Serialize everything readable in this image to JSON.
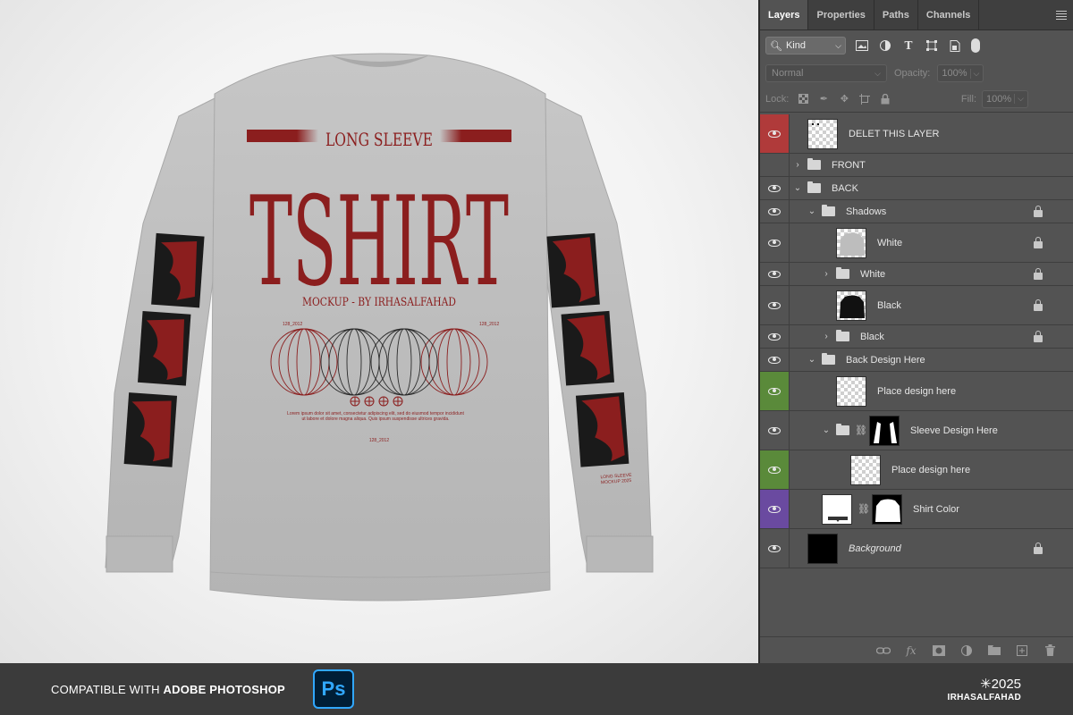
{
  "colors": {
    "accent_red": "#8b1e1e",
    "shirt_gray": "#bdbdbd",
    "layer_red": "#b03a3a",
    "layer_green": "#5a8a3a",
    "layer_purple": "#6a4aa0"
  },
  "mockup": {
    "title_top": "LONG SLEEVE",
    "title_main": "TSHIRT",
    "subtitle": "MOCKUP - BY IRHASALFAHAD",
    "small_left": "128_2012",
    "small_right": "128_2012",
    "lorem": "Lorem ipsum dolor sit amet, consectetur adipiscing elit, sed do eiusmod tempor incididunt ut labore et dolore magna aliqua. Quis ipsum suspendisse ultrices gravida.",
    "small_bottom": "128_2012",
    "sleeve_text": "LONG SLEEVE MOCKUP 2025"
  },
  "panel": {
    "tabs": [
      "Layers",
      "Properties",
      "Paths",
      "Channels"
    ],
    "active_tab": "Layers",
    "filter_kind": "Kind",
    "blend_mode": "Normal",
    "opacity_label": "Opacity:",
    "opacity_value": "100%",
    "lock_label": "Lock:",
    "fill_label": "Fill:",
    "fill_value": "100%",
    "layers": [
      {
        "name": "DELET THIS LAYER",
        "visible": true,
        "color": "red",
        "indent": 0,
        "type": "layer",
        "thumb": "checker-dark",
        "locked": false
      },
      {
        "name": "FRONT",
        "visible": false,
        "color": "",
        "indent": 0,
        "type": "group-closed",
        "locked": false
      },
      {
        "name": "BACK",
        "visible": true,
        "color": "",
        "indent": 0,
        "type": "group-open",
        "locked": false
      },
      {
        "name": "Shadows",
        "visible": true,
        "color": "",
        "indent": 1,
        "type": "group-open",
        "locked": true
      },
      {
        "name": "White",
        "visible": true,
        "color": "",
        "indent": 2,
        "type": "layer",
        "thumb": "shirt-gray",
        "locked": true
      },
      {
        "name": "White",
        "visible": true,
        "color": "",
        "indent": 2,
        "type": "group-closed",
        "locked": true
      },
      {
        "name": "Black",
        "visible": true,
        "color": "",
        "indent": 2,
        "type": "layer",
        "thumb": "shirt-black",
        "locked": true
      },
      {
        "name": "Black",
        "visible": true,
        "color": "",
        "indent": 2,
        "type": "group-closed",
        "locked": true
      },
      {
        "name": "Back Design Here",
        "visible": true,
        "color": "",
        "indent": 1,
        "type": "group-open",
        "locked": false
      },
      {
        "name": "Place design here",
        "visible": true,
        "color": "green",
        "indent": 2,
        "type": "layer",
        "thumb": "checker",
        "locked": false
      },
      {
        "name": "Sleeve Design Here",
        "visible": true,
        "color": "",
        "indent": 2,
        "type": "group-open-mask",
        "locked": false
      },
      {
        "name": "Place design here",
        "visible": true,
        "color": "green",
        "indent": 3,
        "type": "layer",
        "thumb": "checker",
        "locked": false
      },
      {
        "name": "Shirt Color",
        "visible": true,
        "color": "purple",
        "indent": 1,
        "type": "fill-mask",
        "locked": false
      },
      {
        "name": "Background",
        "visible": true,
        "color": "",
        "indent": 0,
        "type": "layer",
        "thumb": "black",
        "locked": true,
        "italic": true
      }
    ],
    "bottom_icons": [
      "link-icon",
      "fx-icon",
      "mask-icon",
      "adjustment-icon",
      "new-group-icon",
      "new-layer-icon",
      "trash-icon"
    ]
  },
  "footer": {
    "compat_prefix": "COMPATIBLE WITH ",
    "compat_app": "ADOBE PHOTOSHOP",
    "ps_logo": "Ps",
    "year": "✳2025",
    "brand": "IRHASALFAHAD"
  }
}
